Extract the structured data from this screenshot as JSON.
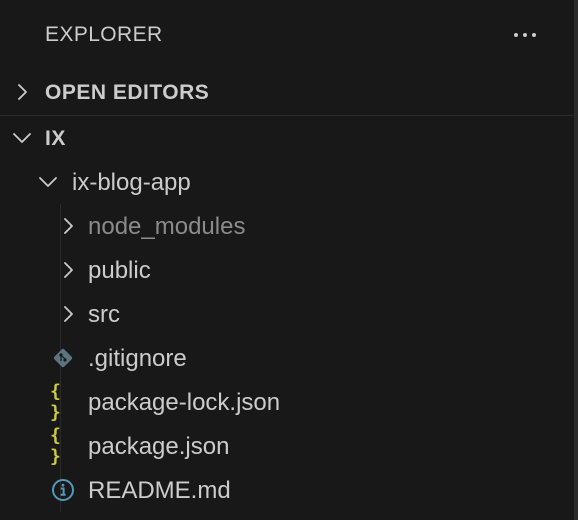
{
  "explorer": {
    "title": "EXPLORER",
    "more_icon": "ellipsis-icon",
    "sections": {
      "open_editors": {
        "label": "OPEN EDITORS",
        "expanded": false
      },
      "workspace": {
        "label": "IX",
        "expanded": true
      }
    },
    "tree": [
      {
        "name": "ix-blog-app",
        "type": "folder",
        "expanded": true,
        "icon": "chevron-down-icon"
      },
      {
        "name": "node_modules",
        "type": "folder",
        "expanded": false,
        "dimmed": true,
        "icon": "chevron-right-icon"
      },
      {
        "name": "public",
        "type": "folder",
        "expanded": false,
        "icon": "chevron-right-icon"
      },
      {
        "name": "src",
        "type": "folder",
        "expanded": false,
        "icon": "chevron-right-icon"
      },
      {
        "name": ".gitignore",
        "type": "file",
        "icon": "git-icon",
        "icon_color": "#41535b"
      },
      {
        "name": "package-lock.json",
        "type": "file",
        "icon": "json-braces-icon",
        "icon_color": "#cbcb41"
      },
      {
        "name": "package.json",
        "type": "file",
        "icon": "json-braces-icon",
        "icon_color": "#cbcb41"
      },
      {
        "name": "README.md",
        "type": "file",
        "icon": "info-icon",
        "icon_color": "#519aba"
      }
    ]
  },
  "colors": {
    "background": "#181818",
    "text": "#cccccc",
    "dim_text": "#8b8b8b",
    "border": "#2b2b2b"
  }
}
